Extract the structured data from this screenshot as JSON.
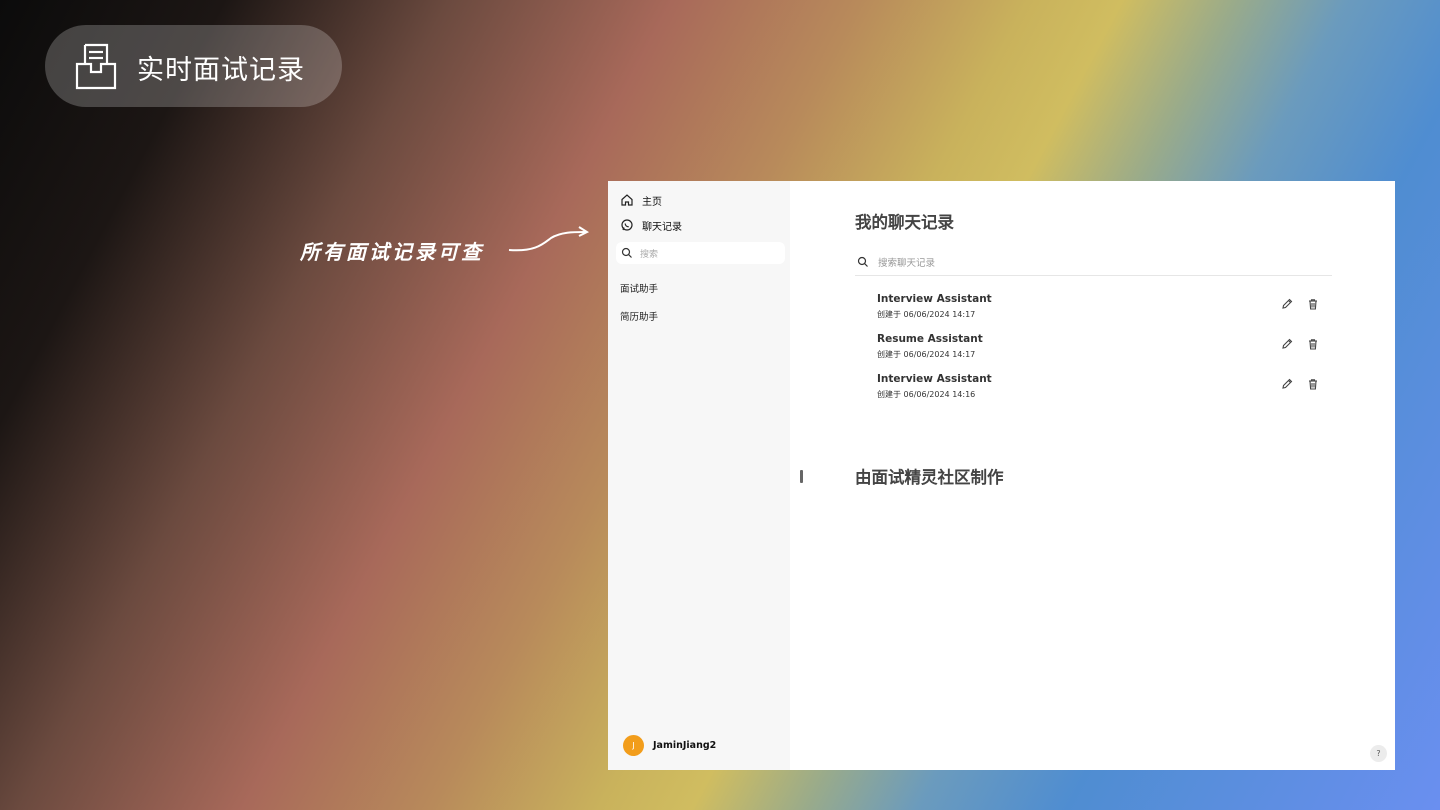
{
  "badge": {
    "title": "实时面试记录",
    "icon": "document-tray-icon"
  },
  "annotation": {
    "text": "所有面试记录可查"
  },
  "sidebar": {
    "nav": [
      {
        "label": "主页",
        "icon": "home-icon"
      },
      {
        "label": "聊天记录",
        "icon": "chat-bubble-icon"
      }
    ],
    "search_placeholder": "搜索",
    "assistants": [
      "面试助手",
      "简历助手"
    ],
    "user": {
      "initial": "J",
      "name": "JaminJiang2"
    }
  },
  "main": {
    "title": "我的聊天记录",
    "search_placeholder": "搜索聊天记录",
    "chats": [
      {
        "name": "Interview Assistant",
        "created": "创建于 06/06/2024 14:17"
      },
      {
        "name": "Resume Assistant",
        "created": "创建于 06/06/2024 14:17"
      },
      {
        "name": "Interview Assistant",
        "created": "创建于 06/06/2024 14:16"
      }
    ],
    "footer": "由面试精灵社区制作",
    "help": "?"
  },
  "colors": {
    "avatar": "#f29d1b",
    "sidebar_bg": "#f7f7f7",
    "title_text": "#444444"
  }
}
